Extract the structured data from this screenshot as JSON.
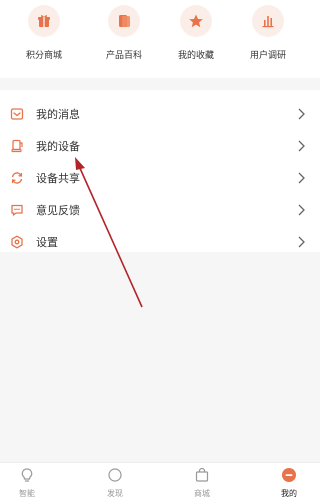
{
  "quick_access": [
    {
      "label": "积分商城",
      "icon": "gift-icon"
    },
    {
      "label": "产品百科",
      "icon": "book-icon"
    },
    {
      "label": "我的收藏",
      "icon": "star-icon"
    },
    {
      "label": "用户调研",
      "icon": "bar-chart-icon"
    }
  ],
  "menu": [
    {
      "label": "我的消息",
      "icon": "message-icon"
    },
    {
      "label": "我的设备",
      "icon": "device-icon"
    },
    {
      "label": "设备共享",
      "icon": "share-sync-icon"
    },
    {
      "label": "意见反馈",
      "icon": "feedback-icon"
    },
    {
      "label": "设置",
      "icon": "settings-icon"
    }
  ],
  "tabs": [
    {
      "label": "智能",
      "icon": "bulb-icon",
      "active": false
    },
    {
      "label": "发现",
      "icon": "compass-icon",
      "active": false
    },
    {
      "label": "商城",
      "icon": "shopping-bag-icon",
      "active": false
    },
    {
      "label": "我的",
      "icon": "profile-icon",
      "active": true
    }
  ],
  "colors": {
    "accent": "#e8734a",
    "icon_bg": "#fbeee8",
    "annotation_arrow": "#b3232a"
  }
}
